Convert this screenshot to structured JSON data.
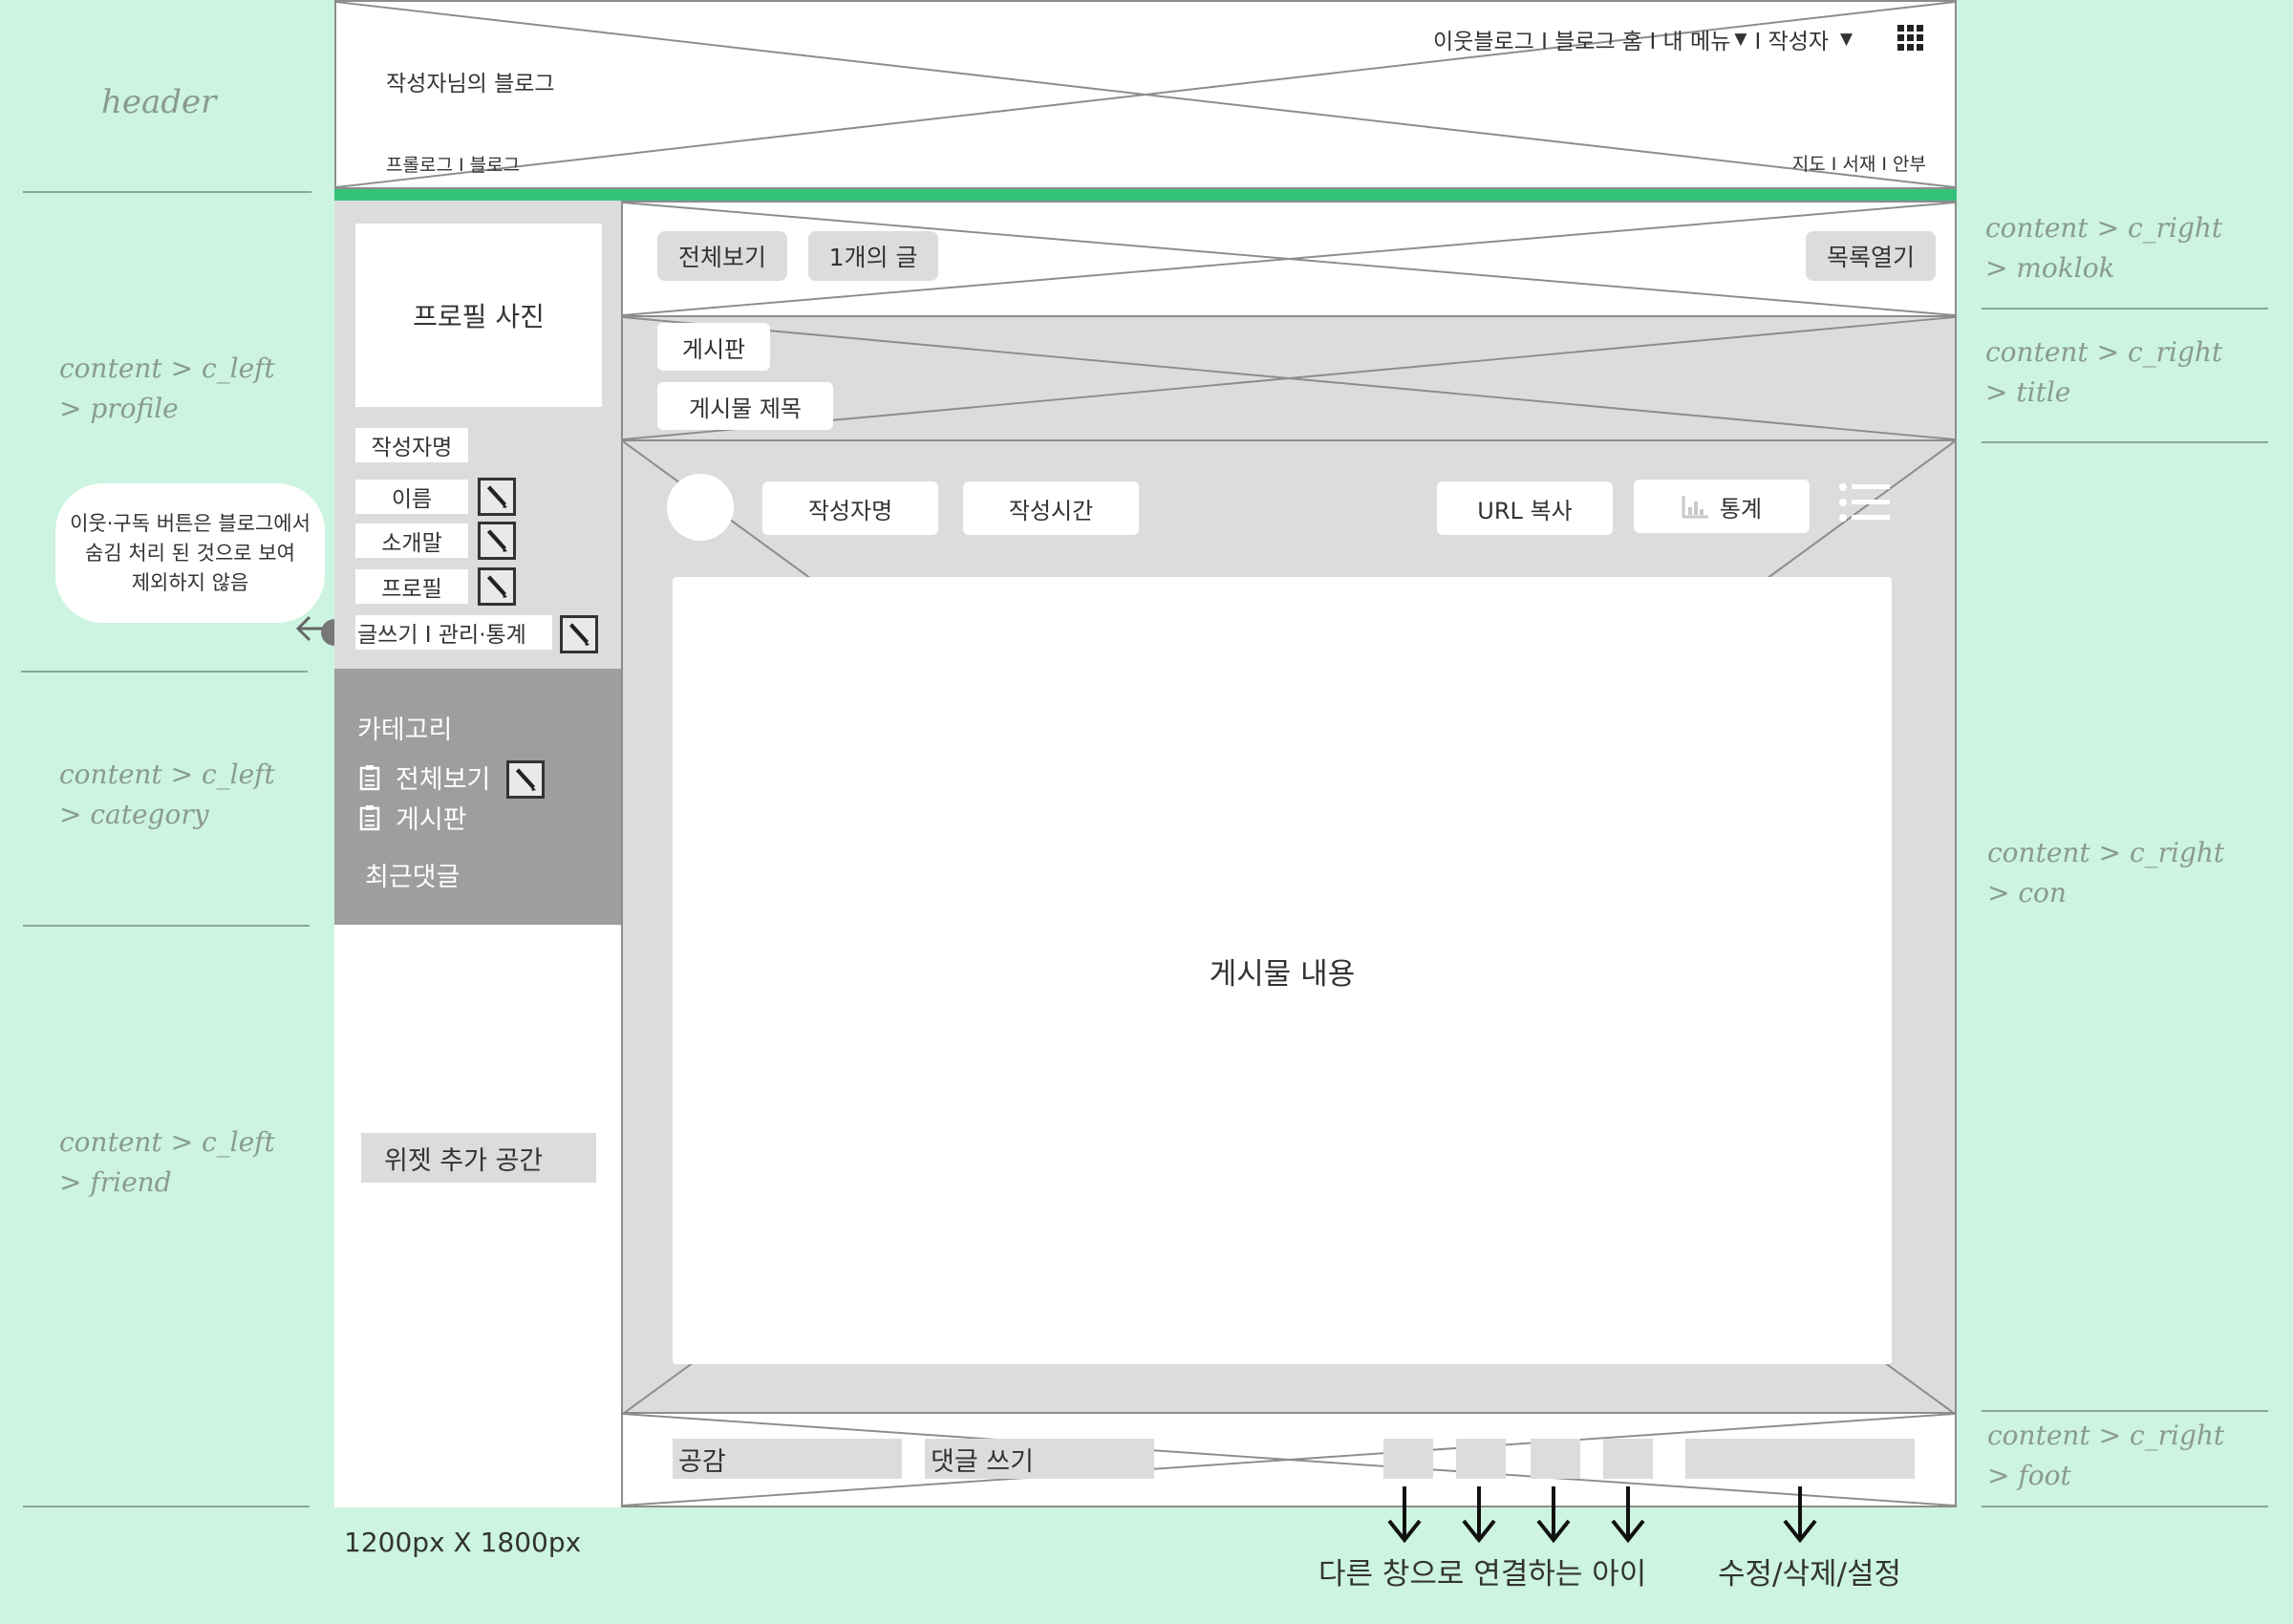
{
  "annotations": {
    "header": "header",
    "profile": [
      "content > c_left",
      "> profile"
    ],
    "category": [
      "content > c_left",
      "> category"
    ],
    "friend": [
      "content > c_left",
      "> friend"
    ],
    "moklok": [
      "content > c_right",
      "> moklok"
    ],
    "title": [
      "content > c_right",
      "> title"
    ],
    "con": [
      "content > c_right",
      "> con"
    ],
    "foot": [
      "content > c_right",
      "> foot"
    ],
    "dimension": "1200px X 1800px",
    "bubble": [
      "이웃·구독 버튼은 블로그에서",
      "숨김 처리 된 것으로 보여",
      "제외하지 않음"
    ],
    "links_caption": "다른 창으로 연결하는 아이",
    "edit_caption": "수정/삭제/설정"
  },
  "header": {
    "blog_title": "작성자님의 블로그",
    "top_nav": "이웃블로그 I 블로그 홈 I 내 메뉴",
    "top_nav_author": "I 작성자",
    "sub_nav_left": "프롤로그 I 블로그",
    "sub_nav_right": "지도 I 서재 I 안부",
    "accent_color": "#34c27a"
  },
  "left": {
    "profile_photo": "프로필 사진",
    "author_name": "작성자명",
    "fields": [
      "이름",
      "소개말",
      "프로필"
    ],
    "actions": "글쓰기 I  관리·통계",
    "category_title": "카테고리",
    "categories": [
      "전체보기",
      "게시판"
    ],
    "recent_comments": "최근댓글",
    "widget": "위젯 추가 공간"
  },
  "right": {
    "view_all": "전체보기",
    "post_count": "1개의 글",
    "open_list": "목록열기",
    "board": "게시판",
    "post_title": "게시물 제목",
    "author": "작성자명",
    "time": "작성시간",
    "url_copy": "URL 복사",
    "stats": "통계",
    "content": "게시물 내용",
    "like": "공감",
    "comment": "댓글 쓰기"
  }
}
